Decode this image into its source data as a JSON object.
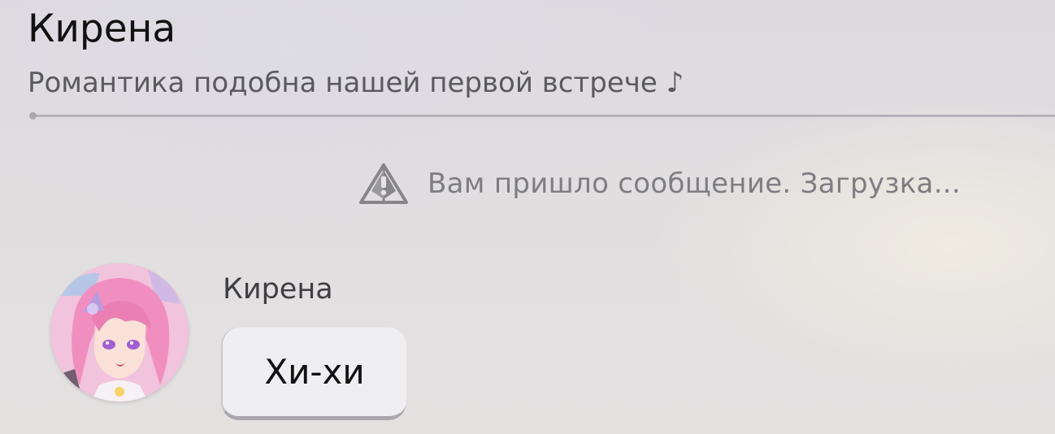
{
  "header": {
    "title": "Кирена",
    "subtitle": "Романтика подобна нашей первой встрече ♪"
  },
  "system_message": {
    "icon": "warning-triangle-icon",
    "text": "Вам пришло сообщение. Загрузка..."
  },
  "messages": [
    {
      "sender": "Кирена",
      "avatar": "kirena-avatar",
      "text": "Хи-хи"
    }
  ],
  "colors": {
    "title": "#111111",
    "subtitle": "#5a5a5e",
    "system_text": "#7d7d82",
    "bubble_bg": "#efeff1",
    "divider": "#b3b2b7"
  }
}
